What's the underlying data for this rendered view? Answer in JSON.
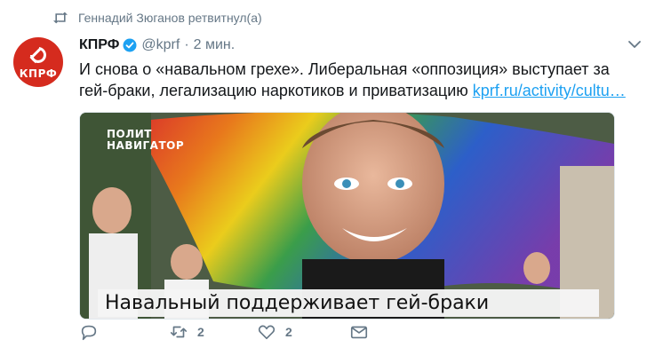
{
  "retweet_context": {
    "text": "Геннадий Зюганов ретвитнул(а)",
    "icon": "retweet-icon"
  },
  "tweet": {
    "author_name": "КПРФ",
    "verified": true,
    "handle": "@kprf",
    "separator": "·",
    "time": "2 мин.",
    "avatar_text": "КПРФ",
    "avatar_color": "#d52b1e",
    "text": "И снова о «навальном грехе». Либеральная «оппозиция» выступает за гей-браки, легализацию наркотиков и приватизацию ",
    "link_text": "kprf.ru/activity/cultu…",
    "link_color": "#1da1f2"
  },
  "card": {
    "logo_line1": "ПОЛИТ",
    "logo_line2": "НАВИГАТОР",
    "caption": "Навальный поддерживает гей-браки"
  },
  "actions": {
    "reply_count": "",
    "retweet_count": "2",
    "like_count": "2"
  },
  "colors": {
    "muted": "#657786",
    "text": "#14171a",
    "verified": "#1da1f2"
  }
}
